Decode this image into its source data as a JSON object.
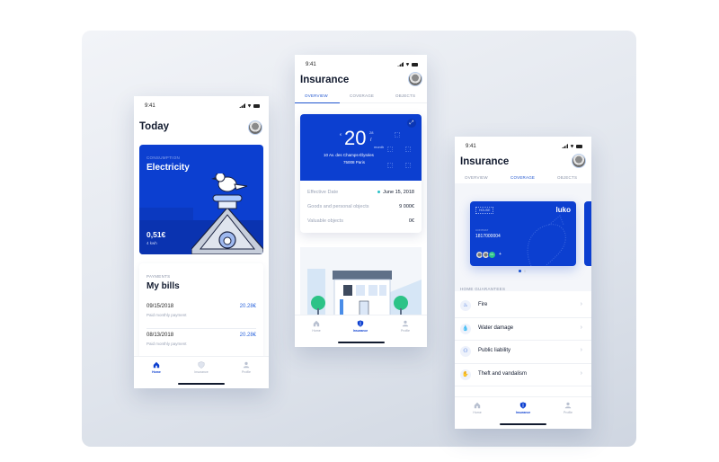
{
  "colors": {
    "brand": "#0c3fd0",
    "accent": "#1f55cf",
    "text": "#111a2e",
    "muted": "#9aa3b6",
    "success": "#2cc387"
  },
  "status_bar": {
    "time": "9:41",
    "icons": [
      "signal-icon",
      "wifi-icon",
      "battery-icon"
    ]
  },
  "phone_today": {
    "title": "Today",
    "consumption_card": {
      "caption": "CONSUMPTION",
      "name": "Electricity",
      "price": "0,51€",
      "unit": "4 kwh"
    },
    "bills_card": {
      "caption": "PAYMENTS",
      "title": "My bills",
      "items": [
        {
          "date": "09/15/2018",
          "description": "Paid monthly payment",
          "amount": "20.28€"
        },
        {
          "date": "08/13/2018",
          "description": "Paid monthly payment",
          "amount": "20.28€"
        }
      ]
    },
    "tabbar": [
      {
        "label": "Home",
        "icon": "home-icon",
        "active": true
      },
      {
        "label": "Insurance",
        "icon": "shield-icon",
        "active": false
      },
      {
        "label": "Profile",
        "icon": "profile-icon",
        "active": false
      }
    ]
  },
  "phone_overview": {
    "title": "Insurance",
    "tabs": [
      {
        "label": "OVERVIEW",
        "active": true
      },
      {
        "label": "COVERAGE",
        "active": false
      },
      {
        "label": "OBJECTS",
        "active": false
      }
    ],
    "price_card": {
      "currency": "€",
      "amount": "20",
      "decimals": "28",
      "period_sep": "/",
      "period": "month",
      "address_line1": "10 Av. des Champs-Élysées",
      "address_line2": "75008 Paris",
      "rows": [
        {
          "label": "Effective Date",
          "value": "June 15, 2018"
        },
        {
          "label": "Goods and personal objects",
          "value": "9 000€"
        },
        {
          "label": "Valuable objects",
          "value": "0€"
        }
      ]
    },
    "tabbar": [
      {
        "label": "Home",
        "icon": "home-icon",
        "active": false
      },
      {
        "label": "Insurance",
        "icon": "shield-icon",
        "active": true
      },
      {
        "label": "Profile",
        "icon": "profile-icon",
        "active": false
      }
    ]
  },
  "phone_coverage": {
    "title": "Insurance",
    "tabs": [
      {
        "label": "OVERVIEW",
        "active": false
      },
      {
        "label": "COVERAGE",
        "active": true
      },
      {
        "label": "OBJECTS",
        "active": false
      }
    ],
    "card": {
      "tag": "HOUSE",
      "brand": "luko",
      "label": "CONTRAT",
      "number": "1817000004",
      "member_initials": "LL",
      "add": "+"
    },
    "pager": {
      "count": 2,
      "active": 1
    },
    "section_title": "HOME GUARANTEES",
    "guarantees": [
      {
        "label": "Fire",
        "icon": "fire-extinguisher-icon"
      },
      {
        "label": "Water damage",
        "icon": "water-icon"
      },
      {
        "label": "Public liability",
        "icon": "people-icon"
      },
      {
        "label": "Theft and vandalism",
        "icon": "theft-icon"
      }
    ],
    "tabbar": [
      {
        "label": "Home",
        "icon": "home-icon",
        "active": false
      },
      {
        "label": "Insurance",
        "icon": "shield-icon",
        "active": true
      },
      {
        "label": "Profile",
        "icon": "profile-icon",
        "active": false
      }
    ]
  }
}
